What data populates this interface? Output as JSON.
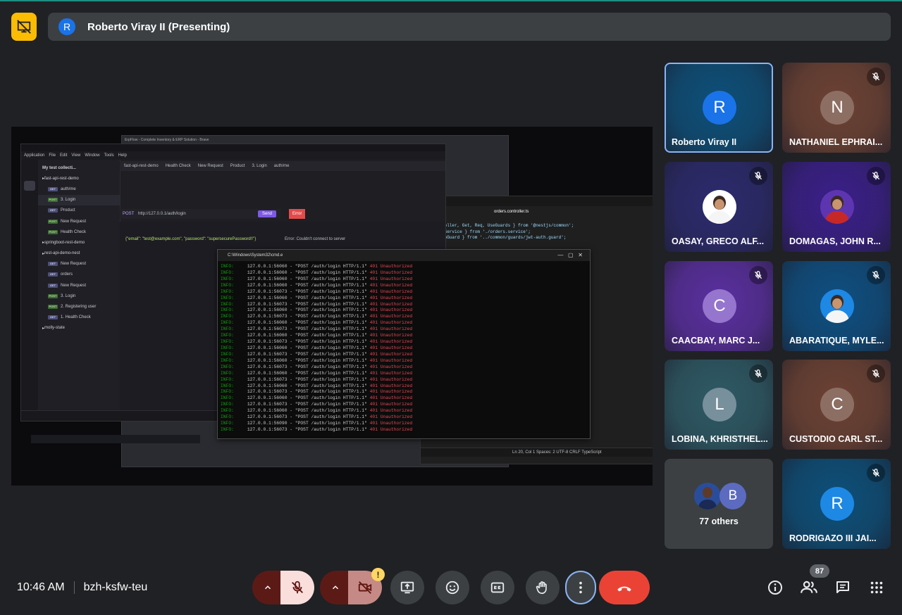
{
  "presenter": {
    "name": "Roberto Viray II (Presenting)",
    "initial": "R"
  },
  "shared_screen": {
    "insomnia": {
      "menu": [
        "Application",
        "File",
        "Edit",
        "View",
        "Window",
        "Tools",
        "Help"
      ],
      "collection": "My test collecti...",
      "tabs": [
        "fast-api-rest-demo",
        "Health Check",
        "New Request",
        "Product",
        "3. Login",
        "auth/me"
      ],
      "method": "POST",
      "url": "http://127.0.0.1/auth/login",
      "send": "Send",
      "status": "Error",
      "body_text": "{\"email\": \"test@example.com\", \"password\": \"supersecurePassword!!\"}",
      "response_text": "Error: Couldn't connect to server",
      "tree": [
        {
          "type": "folder",
          "label": "fast-api-rest-demo"
        },
        {
          "type": "item",
          "method": "GET",
          "label": "auth/me"
        },
        {
          "type": "item",
          "method": "POST",
          "label": "3. Login"
        },
        {
          "type": "item",
          "method": "GET",
          "label": "Product"
        },
        {
          "type": "item",
          "method": "POST",
          "label": "New Request"
        },
        {
          "type": "item",
          "method": "POST",
          "label": "Health Check"
        },
        {
          "type": "folder",
          "label": "springboot-rest-demo"
        },
        {
          "type": "folder",
          "label": "rest-api-demo-nest"
        },
        {
          "type": "item",
          "method": "GET",
          "label": "New Request"
        },
        {
          "type": "item",
          "method": "GET",
          "label": "orders"
        },
        {
          "type": "item",
          "method": "GET",
          "label": "New Request"
        },
        {
          "type": "item",
          "method": "POST",
          "label": "3. Login"
        },
        {
          "type": "item",
          "method": "POST",
          "label": "2. Registering user"
        },
        {
          "type": "item",
          "method": "GET",
          "label": "1. Health Check"
        },
        {
          "type": "folder",
          "label": "molly-state"
        }
      ]
    },
    "browser_title": "ErpFlow - Complete Inventory & ERP Solution - Brave",
    "vscode": {
      "tab": "orders.controller.ts",
      "code": [
        "roller, Get, Req, UseGuards } from '@nestjs/common';",
        "sService } from './orders.service';",
        "thGuard } from '../common/guards/jwt-auth.guard';"
      ],
      "status": "Ln 20, Col 1   Spaces: 2   UTF-8   CRLF   TypeScript"
    },
    "cmd": {
      "title": "C:\\Windows\\System32\\cmd.e",
      "prefix": "INFO:",
      "lines": [
        {
          "addr": "127.0.0.1:56060",
          "req": "\"POST /auth/login HTTP/1.1\"",
          "status": "401 Unauthorized"
        },
        {
          "addr": "127.0.0.1:56060",
          "req": "\"POST /auth/login HTTP/1.1\"",
          "status": "401 Unauthorized"
        },
        {
          "addr": "127.0.0.1:56060",
          "req": "\"POST /auth/login HTTP/1.1\"",
          "status": "401 Unauthorized"
        },
        {
          "addr": "127.0.0.1:56060",
          "req": "\"POST /auth/login HTTP/1.1\"",
          "status": "401 Unauthorized"
        },
        {
          "addr": "127.0.0.1:56073",
          "req": "\"POST /auth/login HTTP/1.1\"",
          "status": "401 Unauthorized"
        },
        {
          "addr": "127.0.0.1:56060",
          "req": "\"POST /auth/login HTTP/1.1\"",
          "status": "401 Unauthorized"
        },
        {
          "addr": "127.0.0.1:56073",
          "req": "\"POST /auth/login HTTP/1.1\"",
          "status": "401 Unauthorized"
        },
        {
          "addr": "127.0.0.1:56060",
          "req": "\"POST /auth/login HTTP/1.1\"",
          "status": "401 Unauthorized"
        },
        {
          "addr": "127.0.0.1:56073",
          "req": "\"POST /auth/login HTTP/1.1\"",
          "status": "401 Unauthorized"
        },
        {
          "addr": "127.0.0.1:56060",
          "req": "\"POST /auth/login HTTP/1.1\"",
          "status": "401 Unauthorized"
        },
        {
          "addr": "127.0.0.1:56073",
          "req": "\"POST /auth/login HTTP/1.1\"",
          "status": "401 Unauthorized"
        },
        {
          "addr": "127.0.0.1:56060",
          "req": "\"POST /auth/login HTTP/1.1\"",
          "status": "401 Unauthorized"
        },
        {
          "addr": "127.0.0.1:56073",
          "req": "\"POST /auth/login HTTP/1.1\"",
          "status": "401 Unauthorized"
        },
        {
          "addr": "127.0.0.1:56060",
          "req": "\"POST /auth/login HTTP/1.1\"",
          "status": "401 Unauthorized"
        },
        {
          "addr": "127.0.0.1:56073",
          "req": "\"POST /auth/login HTTP/1.1\"",
          "status": "401 Unauthorized"
        },
        {
          "addr": "127.0.0.1:56060",
          "req": "\"POST /auth/login HTTP/1.1\"",
          "status": "401 Unauthorized"
        },
        {
          "addr": "127.0.0.1:56073",
          "req": "\"POST /auth/login HTTP/1.1\"",
          "status": "401 Unauthorized"
        },
        {
          "addr": "127.0.0.1:56060",
          "req": "\"POST /auth/login HTTP/1.1\"",
          "status": "401 Unauthorized"
        },
        {
          "addr": "127.0.0.1:56073",
          "req": "\"POST /auth/login HTTP/1.1\"",
          "status": "401 Unauthorized"
        },
        {
          "addr": "127.0.0.1:56060",
          "req": "\"POST /auth/login HTTP/1.1\"",
          "status": "401 Unauthorized"
        },
        {
          "addr": "127.0.0.1:56073",
          "req": "\"POST /auth/login HTTP/1.1\"",
          "status": "401 Unauthorized"
        },
        {
          "addr": "127.0.0.1:56060",
          "req": "\"POST /auth/login HTTP/1.1\"",
          "status": "401 Unauthorized"
        },
        {
          "addr": "127.0.0.1:56073",
          "req": "\"POST /auth/login HTTP/1.1\"",
          "status": "401 Unauthorized"
        },
        {
          "addr": "127.0.0.1:56060",
          "req": "\"POST /auth/login HTTP/1.1\"",
          "status": "401 Unauthorized"
        },
        {
          "addr": "127.0.0.1:56073",
          "req": "\"POST /auth/login HTTP/1.1\"",
          "status": "401 Unauthorized"
        },
        {
          "addr": "127.0.0.1:56090",
          "req": "\"POST /auth/login HTTP/1.1\"",
          "status": "401 Unauthorized"
        },
        {
          "addr": "127.0.0.1:56073",
          "req": "\"POST /auth/login HTTP/1.1\"",
          "status": "401 Unauthorized"
        }
      ]
    }
  },
  "participants": [
    {
      "name": "Roberto Viray II",
      "initial": "R",
      "avatar_color": "#1a73e8",
      "bg": "#0d4f7a",
      "muted": false,
      "photo": false,
      "active": true
    },
    {
      "name": "NATHANIEL EPHRAI...",
      "initial": "N",
      "avatar_color": "#8d6e63",
      "bg": "#6d4234",
      "muted": true,
      "photo": false
    },
    {
      "name": "OASAY, GRECO ALF...",
      "initial": "",
      "avatar_color": "#ffffff",
      "bg": "#2c2a6e",
      "muted": true,
      "photo": true
    },
    {
      "name": "DOMAGAS, JOHN R...",
      "initial": "",
      "avatar_color": "#5e35b1",
      "bg": "#3a1f8a",
      "muted": true,
      "photo": true
    },
    {
      "name": "CAACBAY, MARC J...",
      "initial": "C",
      "avatar_color": "#9575cd",
      "bg": "#5a2fa0",
      "muted": true,
      "photo": false
    },
    {
      "name": "ABARATIQUE, MYLE...",
      "initial": "",
      "avatar_color": "#1e88e5",
      "bg": "#0e4f82",
      "muted": true,
      "photo": true
    },
    {
      "name": "LOBINA, KHRISTHEL...",
      "initial": "L",
      "avatar_color": "#78909c",
      "bg": "#2e5a66",
      "muted": true,
      "photo": false
    },
    {
      "name": "CUSTODIO CARL ST...",
      "initial": "C",
      "avatar_color": "#8d6e63",
      "bg": "#6d4234",
      "muted": true,
      "photo": false
    },
    {
      "name": "RODRIGAZO III JAI...",
      "initial": "R",
      "avatar_color": "#1e88e5",
      "bg": "#0d4f7a",
      "muted": true,
      "photo": false
    }
  ],
  "others": {
    "label": "77 others",
    "initial": "B"
  },
  "meeting": {
    "time": "10:46 AM",
    "code": "bzh-ksfw-teu"
  },
  "controls": {
    "warning": "!",
    "people_count": "87"
  },
  "colors": {
    "end_call": "#ea4335",
    "mic_off_bg": "#f9dedc",
    "more_active_ring": "#8ab4f8",
    "presenting": "#fbbc04"
  }
}
